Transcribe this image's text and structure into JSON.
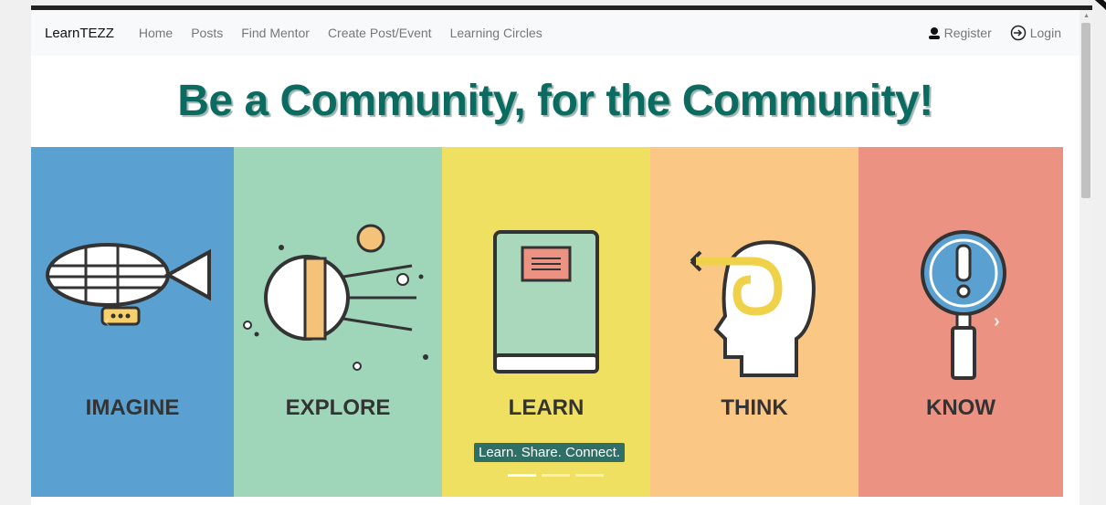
{
  "navbar": {
    "brand": "LearnTEZZ",
    "links": [
      "Home",
      "Posts",
      "Find Mentor",
      "Create Post/Event",
      "Learning Circles"
    ],
    "register": "Register",
    "login": "Login"
  },
  "hero": {
    "title": "Be a Community, for the Community!"
  },
  "carousel": {
    "panels": [
      "IMAGINE",
      "EXPLORE",
      "LEARN",
      "THINK",
      "KNOW"
    ],
    "caption": "Learn. Share. Connect.",
    "indicator_count": 3,
    "active_indicator": 0
  },
  "colors": {
    "title": "#0c6b60",
    "imagine": "#5aa0d0",
    "explore": "#9fd6b9",
    "learn": "#f0e062",
    "think": "#fbc784",
    "know": "#ec9282"
  },
  "icons": {
    "register": "user-icon",
    "login": "login-arrow-icon"
  }
}
